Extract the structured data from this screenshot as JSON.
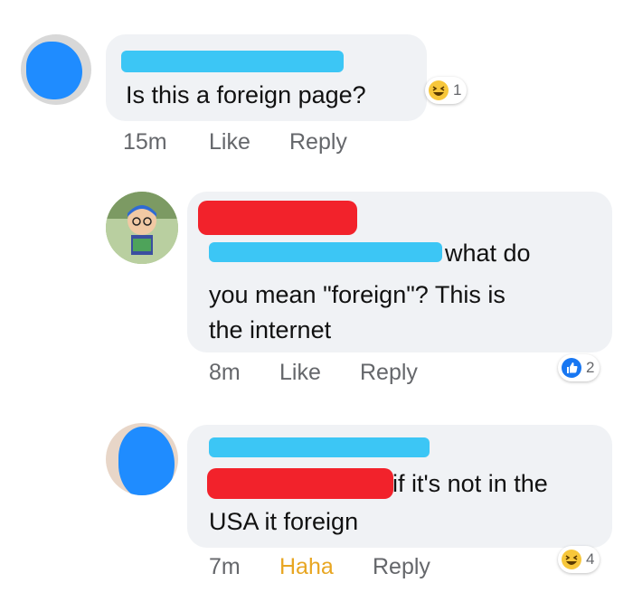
{
  "comments": [
    {
      "text": "Is this a foreign page?",
      "time": "15m",
      "like": "Like",
      "reply": "Reply",
      "reaction_icon": "haha-icon",
      "reaction_count": "1"
    },
    {
      "text_line1": "what do",
      "text_rest": "you mean \"foreign\"? This is\nthe internet",
      "time": "8m",
      "like": "Like",
      "reply": "Reply",
      "reaction_icon": "like-icon",
      "reaction_count": "2"
    },
    {
      "text_line1": "if it's not in the",
      "text_rest": "USA it foreign",
      "time": "7m",
      "reaction_label": "Haha",
      "reply": "Reply",
      "reaction_icon": "haha-icon",
      "reaction_count": "4"
    }
  ],
  "colors": {
    "bubble": "#f0f2f5",
    "redaction_cyan": "#3cc6f5",
    "redaction_red": "#f2222b",
    "avatar_blot": "#1f8cff",
    "haha": "#e8a622",
    "like_blue": "#1877f2"
  }
}
